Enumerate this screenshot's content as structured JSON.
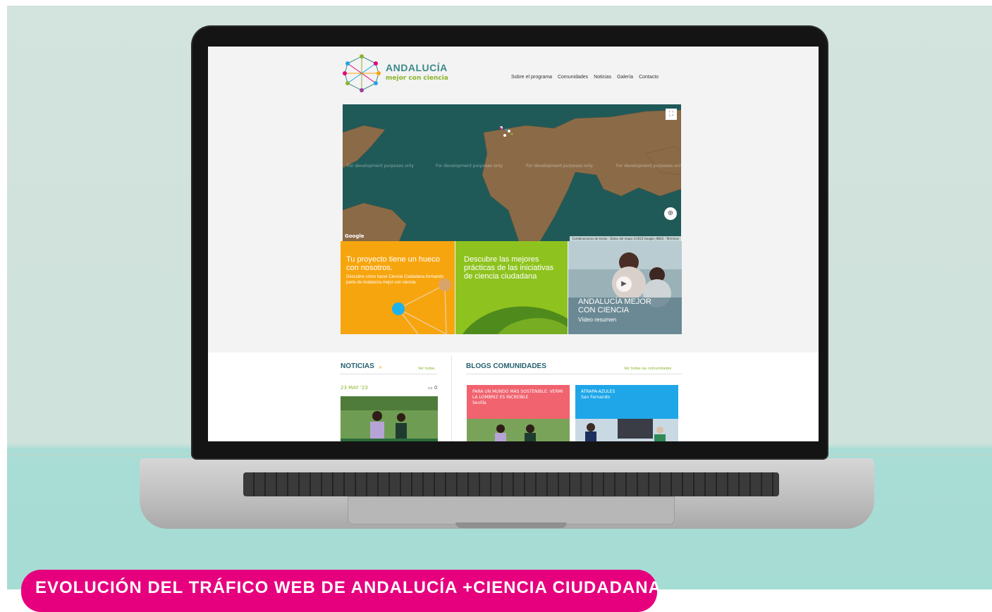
{
  "site": {
    "brand_name": "ANDALUCÍA",
    "brand_tagline": "mejor con ciencia"
  },
  "nav": [
    {
      "label": "Sobre el programa"
    },
    {
      "label": "Comunidades"
    },
    {
      "label": "Noticias"
    },
    {
      "label": "Galería"
    },
    {
      "label": "Contacto"
    }
  ],
  "map": {
    "watermark": "For development purposes only",
    "provider": "Google",
    "footer": "Combinaciones de teclas · Datos del mapa ©2023 Google, INEGI · Términos",
    "fullscreen_icon": "fullscreen-icon",
    "locate_icon": "locate-icon"
  },
  "tiles": {
    "project": {
      "title": "Tu proyecto tiene un hueco con nosotros.",
      "text": "Descubre cómo hacer Ciencia Ciudadana formando parte de Andalucía mejor con ciencia."
    },
    "practices": {
      "title": "Descubre las mejores prácticas de las iniciativas de ciencia ciudadana"
    },
    "video": {
      "title": "ANDALUCÍA MEJOR CON CIENCIA",
      "subtitle": "Vídeo resumen"
    }
  },
  "news": {
    "title": "NOTICIAS",
    "link": "Ver todas",
    "date": "23 MAY '23",
    "comments": "0"
  },
  "blogs": {
    "title": "BLOGS COMUNIDADES",
    "link": "Ver todas las comunidades",
    "cards": [
      {
        "title": "PARA UN MUNDO MÁS SOSTENIBLE: VERMI LA LOMBRIZ ES INCREÍBLE",
        "location": "Sevilla",
        "color": "#f0636f"
      },
      {
        "title": "ATRAPA-AZULES",
        "location": "San Fernando",
        "color": "#1ea6e8"
      }
    ]
  },
  "banner": {
    "text": "EVOLUCIÓN DEL TRÁFICO WEB DE ANDALUCÍA +CIENCIA CIUDADANA"
  },
  "colors": {
    "brand_teal": "#3c8a8a",
    "accent_green": "#8ab52a",
    "tile_orange": "#f7a50e",
    "tile_green": "#8ec31f",
    "banner_pink": "#e6007e",
    "map_sea": "#1f5a58",
    "map_land": "#8b6b47"
  }
}
